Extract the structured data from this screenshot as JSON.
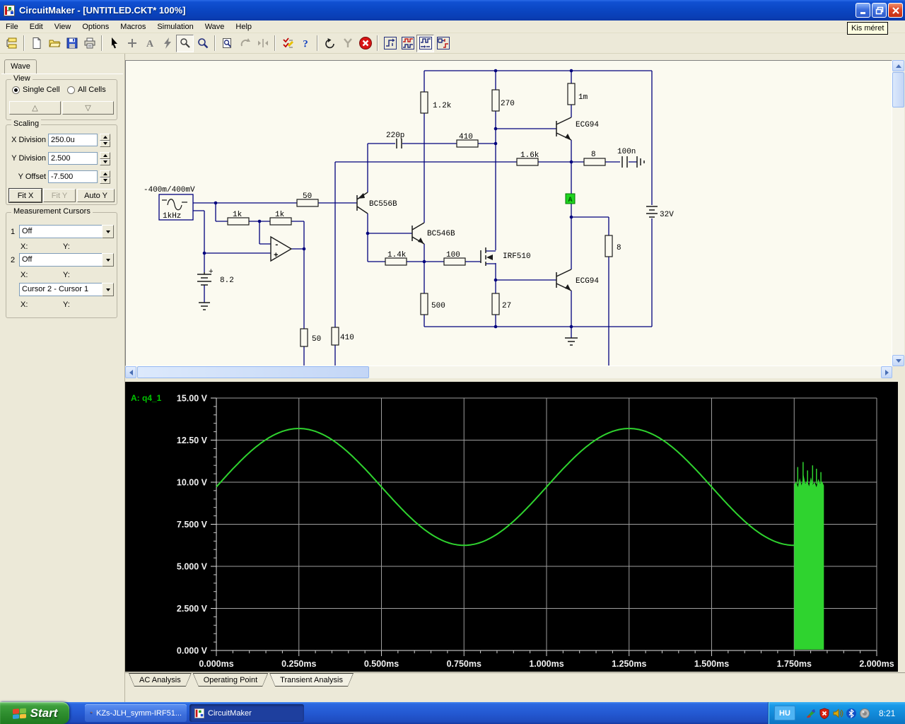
{
  "window": {
    "title": "CircuitMaker - [UNTITLED.CKT* 100%]",
    "tooltip": "Kis méret"
  },
  "menu": {
    "items": [
      "File",
      "Edit",
      "View",
      "Options",
      "Macros",
      "Simulation",
      "Wave",
      "Help"
    ]
  },
  "toolbar": {
    "glyphs": {
      "text_tool": "A",
      "help": "?"
    },
    "buttons": [
      {
        "name": "component-browser",
        "state": "normal"
      },
      {
        "name": "new-file",
        "state": "normal"
      },
      {
        "name": "open-file",
        "state": "normal"
      },
      {
        "name": "save-file",
        "state": "normal"
      },
      {
        "name": "print",
        "state": "normal"
      },
      {
        "name": "arrow-tool",
        "state": "normal"
      },
      {
        "name": "wire-tool",
        "state": "normal"
      },
      {
        "name": "text-tool",
        "state": "normal"
      },
      {
        "name": "delete-tool",
        "state": "normal"
      },
      {
        "name": "probe-tool",
        "state": "pressed"
      },
      {
        "name": "zoom-tool",
        "state": "normal"
      },
      {
        "name": "zoom-window",
        "state": "normal"
      },
      {
        "name": "rotate",
        "state": "disabled"
      },
      {
        "name": "mirror",
        "state": "disabled"
      },
      {
        "name": "simulation-setup",
        "state": "normal"
      },
      {
        "name": "help",
        "state": "normal"
      },
      {
        "name": "reset-simulation",
        "state": "normal"
      },
      {
        "name": "test-probe",
        "state": "disabled"
      },
      {
        "name": "stop-simulation",
        "state": "normal"
      },
      {
        "name": "step-simulation",
        "state": "normal"
      },
      {
        "name": "digital-display",
        "state": "normal"
      },
      {
        "name": "waveforms-window",
        "state": "pressed"
      },
      {
        "name": "mixed-display",
        "state": "normal"
      }
    ]
  },
  "left_panel": {
    "tab": "Wave",
    "view": {
      "legend": "View",
      "options": [
        {
          "label": "Single Cell",
          "selected": true
        },
        {
          "label": "All Cells",
          "selected": false
        }
      ],
      "up_symbol": "△",
      "down_symbol": "▽"
    },
    "scaling": {
      "legend": "Scaling",
      "x_division_label": "X Division",
      "x_division": "250.0u",
      "y_division_label": "Y Division",
      "y_division": "2.500",
      "y_offset_label": "Y Offset",
      "y_offset": "-7.500",
      "fit_x": "Fit X",
      "fit_y": "Fit Y",
      "auto_y": "Auto Y"
    },
    "cursors": {
      "legend": "Measurement Cursors",
      "row1_index": "1",
      "row1_value": "Off",
      "row2_index": "2",
      "row2_value": "Off",
      "diff_value": "Cursor 2 - Cursor 1",
      "x_label": "X:",
      "y_label": "Y:"
    }
  },
  "schematic": {
    "labels": {
      "src_range": "-400m/400mV",
      "src_freq": "1kHz",
      "r_in": "50",
      "r_fb1": "1k",
      "r_fb2": "1k",
      "batt_bias": "8.2",
      "plus_sign": "+",
      "opamp_minus": "-",
      "opamp_plus": "+",
      "q1": "BC556B",
      "q2": "BC546B",
      "c_comp": "220p",
      "r_410": "410",
      "r_1_2k": "1.2k",
      "r_270": "270",
      "r_1m": "1m",
      "q3": "ECG94",
      "r_1_6k": "1.6k",
      "r_8": "8",
      "c_out": "100n",
      "r_1_4k": "1.4k",
      "r_100": "100",
      "q4": "IRF510",
      "r_500": "500",
      "r_27": "27",
      "q5": "ECG94",
      "r_load": "8",
      "batt_main": "32V",
      "r_50b": "50",
      "r_410b": "410",
      "probe": "A"
    }
  },
  "waveform": {
    "trace_label": "A: q4_1",
    "y_labels": [
      "15.00 V",
      "12.50 V",
      "10.00 V",
      "7.500 V",
      "5.000 V",
      "2.500 V",
      "0.000 V"
    ],
    "x_labels": [
      "0.000ms",
      "0.250ms",
      "0.500ms",
      "0.750ms",
      "1.000ms",
      "1.250ms",
      "1.500ms",
      "1.750ms",
      "2.000ms"
    ]
  },
  "chart_data": {
    "type": "line",
    "title": "",
    "xlabel": "",
    "ylabel": "",
    "x_unit": "ms",
    "y_unit": "V",
    "x_range": [
      0,
      2
    ],
    "y_range": [
      0,
      15
    ],
    "x_ticks": [
      0,
      0.25,
      0.5,
      0.75,
      1.0,
      1.25,
      1.5,
      1.75,
      2.0
    ],
    "y_ticks": [
      15,
      12.5,
      10,
      7.5,
      5,
      2.5,
      0
    ],
    "grid": true,
    "legend_position": "top-left",
    "color": "#2FD32F",
    "series": [
      {
        "name": "A: q4_1",
        "sine": {
          "mean_v": 9.72,
          "amplitude_v": 3.47,
          "period_ms": 1.0,
          "phase_rad": 0,
          "t_start_ms": 0,
          "t_end_ms": 1.75
        },
        "oscillation_burst": {
          "t_start_ms": 1.75,
          "t_end_ms": 1.84,
          "v_base": 0.05,
          "v_top": 9.9,
          "v_spike_max": 11.2
        }
      }
    ]
  },
  "tabs": {
    "items": [
      "AC Analysis",
      "Operating Point",
      "Transient Analysis"
    ],
    "active": "Transient Analysis"
  },
  "taskbar": {
    "start": "Start",
    "tasks": [
      {
        "label": "KZs-JLH_symm-IRF51...",
        "active": false
      },
      {
        "label": "CircuitMaker",
        "active": true
      }
    ],
    "tray": {
      "language": "HU",
      "time": "8:21",
      "icons": [
        "graphics-pen-icon",
        "security-alert-icon",
        "volume-icon",
        "bluetooth-icon",
        "device-icon"
      ]
    }
  }
}
